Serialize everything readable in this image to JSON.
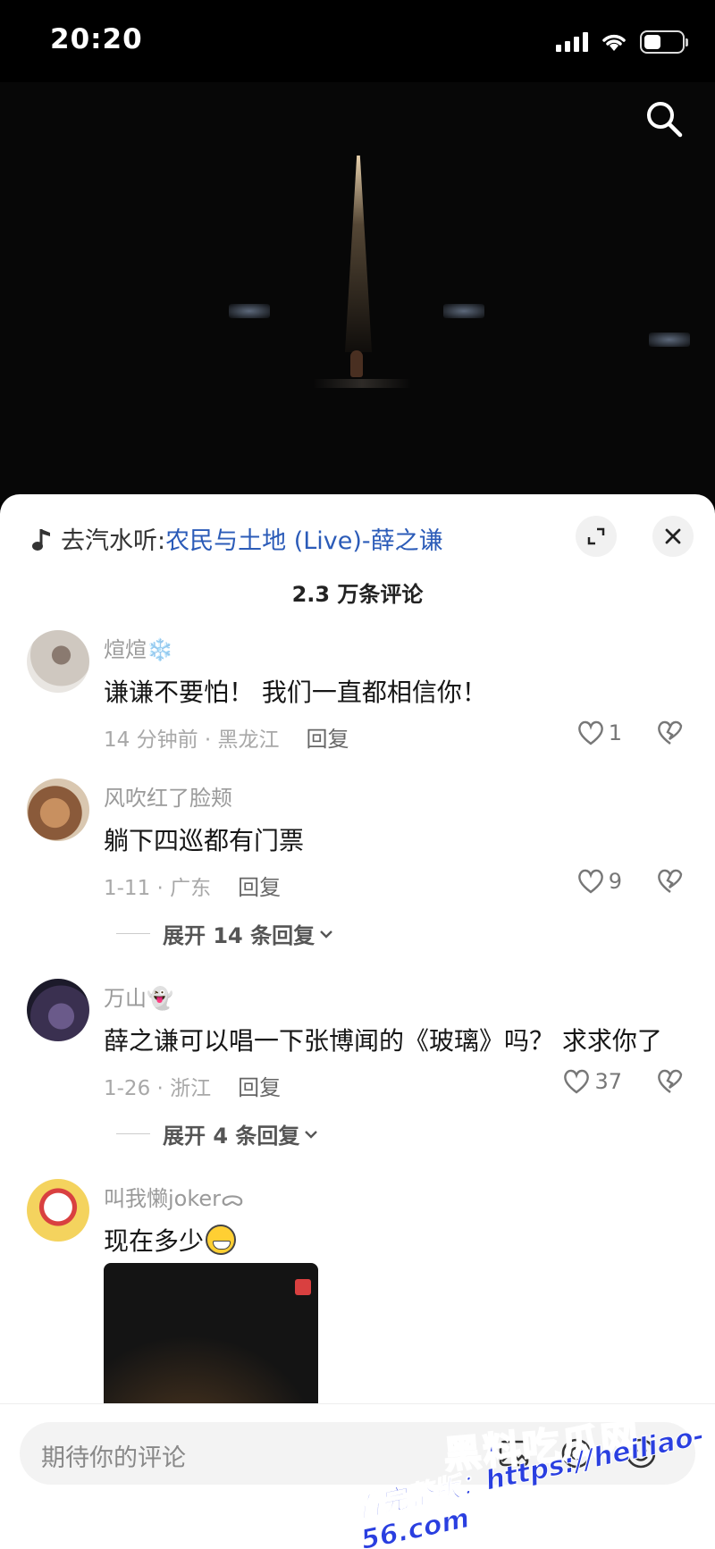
{
  "status_bar": {
    "time": "20:20",
    "battery_level": 0.45
  },
  "video": {
    "search_icon": "search-icon"
  },
  "panel": {
    "music_prefix": "去汽水听:",
    "music_title": "农民与土地 (Live)-薛之谦",
    "comment_count": "2.3 万条评论",
    "expand_icon": "expand-icon",
    "close_icon": "close-icon"
  },
  "comments": [
    {
      "username": "煊煊❄️",
      "text": "谦谦不要怕！ 我们一直都相信你！",
      "meta": "14 分钟前 · 黑龙江",
      "reply": "回复",
      "likes": "1"
    },
    {
      "username": "风吹红了脸颊",
      "text": "躺下四巡都有门票",
      "meta": "1-11 · 广东",
      "reply": "回复",
      "likes": "9",
      "expand": "展开 14 条回复"
    },
    {
      "username": "万山👻",
      "text": "薛之谦可以唱一下张博闻的《玻璃》吗？ 求求你了",
      "meta": "1-26 · 浙江",
      "reply": "回复",
      "likes": "37",
      "expand": "展开 4 条回复"
    },
    {
      "username": "叫我懒jokerᯅ",
      "text": "现在多少"
    }
  ],
  "input": {
    "placeholder": "期待你的评论"
  },
  "watermark": {
    "brand": "黑料吃瓜网",
    "url": "看完整版：https://heiliao-56.com"
  },
  "colors": {
    "link": "#2b5bb8",
    "watermark": "#2a3fe0"
  }
}
